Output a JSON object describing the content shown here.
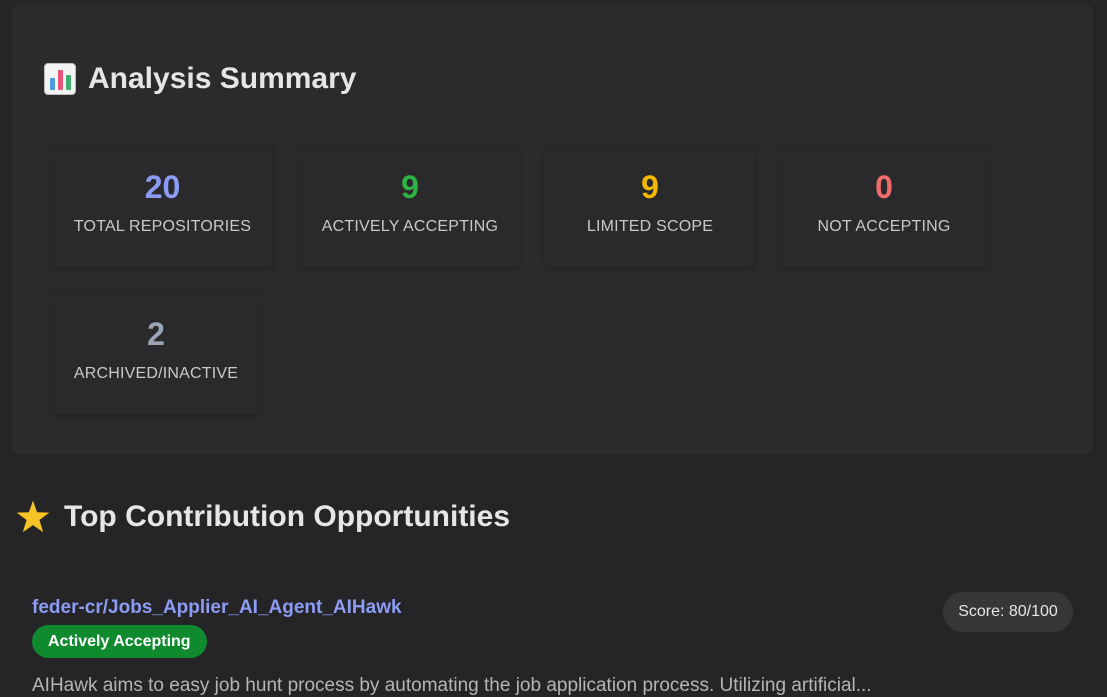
{
  "summary": {
    "title": "Analysis Summary",
    "icon": "bar-chart-icon",
    "stats": [
      {
        "value": "20",
        "label": "TOTAL REPOSITORIES",
        "color": "#8c9cf5"
      },
      {
        "value": "9",
        "label": "ACTIVELY ACCEPTING",
        "color": "#2fb344"
      },
      {
        "value": "9",
        "label": "LIMITED SCOPE",
        "color": "#f5b800"
      },
      {
        "value": "0",
        "label": "NOT ACCEPTING",
        "color": "#f26b6b"
      },
      {
        "value": "2",
        "label": "ARCHIVED/INACTIVE",
        "color": "#9aa4b2"
      }
    ]
  },
  "opportunities": {
    "title": "Top Contribution Opportunities",
    "icon": "star-icon",
    "items": [
      {
        "repo": "feder-cr/Jobs_Applier_AI_Agent_AIHawk",
        "status": "Actively Accepting",
        "status_color": "#0f8a2f",
        "score": "Score: 80/100",
        "description": "AIHawk aims to easy job hunt process by automating the job application process. Utilizing artificial..."
      }
    ]
  }
}
